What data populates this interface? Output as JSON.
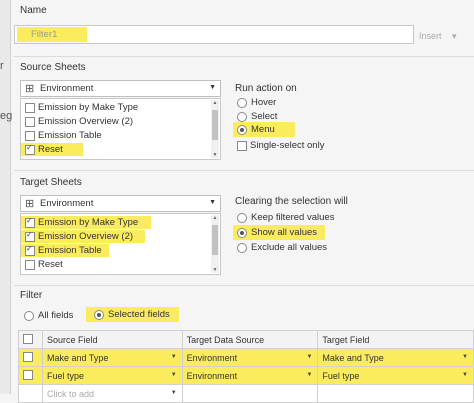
{
  "edge": {
    "chars": [
      "r",
      "eg"
    ]
  },
  "name": {
    "heading": "Name",
    "value": "Filter1",
    "insert_label": "Insert",
    "insert_arrow": "▾"
  },
  "source_sheets": {
    "heading": "Source Sheets",
    "dropdown": {
      "icon": "grid-icon",
      "value": "Environment"
    },
    "items": [
      {
        "label": "Emission by Make Type",
        "checked": false
      },
      {
        "label": "Emission Overview (2)",
        "checked": false
      },
      {
        "label": "Emission Table",
        "checked": false
      },
      {
        "label": "Reset",
        "checked": true
      }
    ]
  },
  "run_action": {
    "heading": "Run action on",
    "options": [
      {
        "label": "Hover",
        "selected": false
      },
      {
        "label": "Select",
        "selected": false
      },
      {
        "label": "Menu",
        "selected": true
      }
    ],
    "single_select": {
      "label": "Single-select only",
      "checked": false
    }
  },
  "target_sheets": {
    "heading": "Target Sheets",
    "dropdown": {
      "icon": "grid-icon",
      "value": "Environment"
    },
    "items": [
      {
        "label": "Emission by Make Type",
        "checked": true
      },
      {
        "label": "Emission Overview (2)",
        "checked": true
      },
      {
        "label": "Emission Table",
        "checked": true
      },
      {
        "label": "Reset",
        "checked": false
      }
    ]
  },
  "clearing": {
    "heading": "Clearing the selection will",
    "options": [
      {
        "label": "Keep filtered values",
        "selected": false
      },
      {
        "label": "Show all values",
        "selected": true
      },
      {
        "label": "Exclude all values",
        "selected": false
      }
    ]
  },
  "filter": {
    "heading": "Filter",
    "options": [
      {
        "label": "All fields",
        "selected": false
      },
      {
        "label": "Selected fields",
        "selected": true
      }
    ],
    "columns": [
      "",
      "Source Field",
      "Target Data Source",
      "Target Field"
    ],
    "rows": [
      {
        "source": "Make and Type",
        "target_ds": "Environment",
        "target_field": "Make and Type"
      },
      {
        "source": "Fuel type",
        "target_ds": "Environment",
        "target_field": "Fuel type"
      }
    ],
    "add_row": {
      "label": "Click to add"
    }
  },
  "highlight_color": "#fbec5d"
}
